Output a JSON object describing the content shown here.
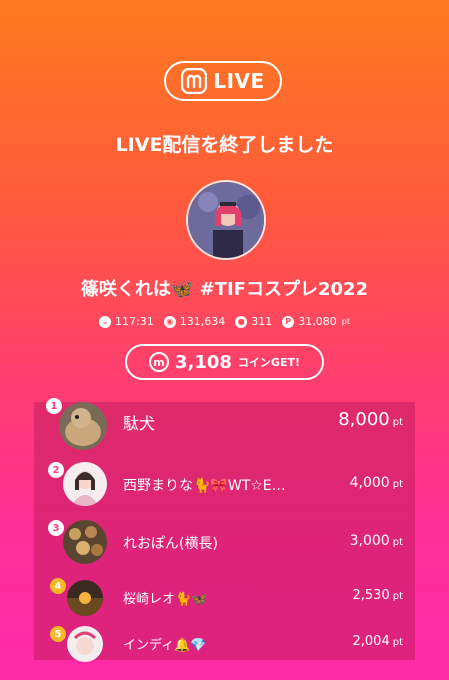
{
  "brand": {
    "label": "LIVE",
    "icon": "m-logo-icon"
  },
  "title": "LIVE配信を終了しました",
  "streamer": {
    "name": "篠咲くれは🦋 #TIFコスプレ2022"
  },
  "stats": {
    "duration": "117:31",
    "views": "131,634",
    "comments": "311",
    "points": "31,080",
    "points_unit": "pt"
  },
  "coins": {
    "value": "3,108",
    "suffix": "コインGET!"
  },
  "ranking": [
    {
      "rank": "1",
      "name": "駄犬",
      "score": "8,000",
      "unit": "pt"
    },
    {
      "rank": "2",
      "name": "西野まりな🐈🎀WT☆E…",
      "score": "4,000",
      "unit": "pt"
    },
    {
      "rank": "3",
      "name": "れおぽん(横長)",
      "score": "3,000",
      "unit": "pt"
    },
    {
      "rank": "4",
      "name": "桜崎レオ🐈🦋",
      "score": "2,530",
      "unit": "pt"
    },
    {
      "rank": "5",
      "name": "インディ🔔💎",
      "score": "2,004",
      "unit": "pt"
    }
  ],
  "colors": {
    "accent_top": "#ff7a1e",
    "accent_bottom": "#ff2aa8",
    "gold": "#f8b827"
  }
}
